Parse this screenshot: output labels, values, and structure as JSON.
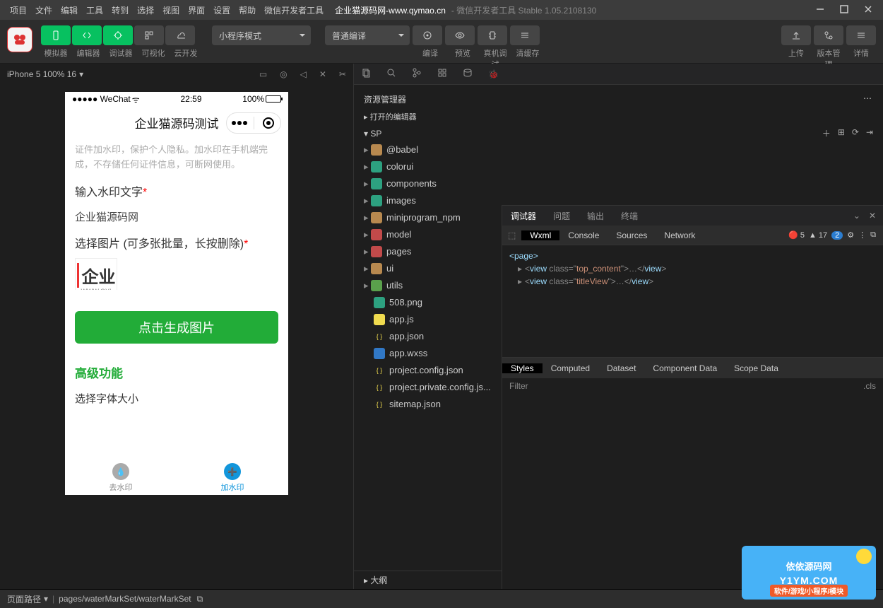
{
  "title_bar": {
    "menus": [
      "项目",
      "文件",
      "编辑",
      "工具",
      "转到",
      "选择",
      "视图",
      "界面",
      "设置",
      "帮助",
      "微信开发者工具"
    ],
    "project_title": "企业猫源码网-www.qymao.cn",
    "sub_title": " - 微信开发者工具 Stable 1.05.2108130"
  },
  "toolbar": {
    "left_labels": [
      "模拟器",
      "编辑器",
      "调试器",
      "可视化",
      "云开发"
    ],
    "mode_select": "小程序模式",
    "compile_select": "普通编译",
    "compile_labels": [
      "编译",
      "预览",
      "真机调试",
      "清缓存"
    ],
    "right_labels": [
      "上传",
      "版本管理",
      "详情"
    ]
  },
  "simulator": {
    "header": "iPhone 5 100% 16",
    "status_time": "22:59",
    "status_left": "●●●●● WeChat",
    "battery": "100%",
    "nav_title": "企业猫源码测试",
    "desc": "证件加水印，保护个人隐私。加水印在手机端完成，不存储任何证件信息，可断网使用。",
    "label_watermark": "输入水印文字",
    "watermark_value": "企业猫源码网",
    "label_images": "选择图片 (可多张批量，长按删除)",
    "thumb_text": "企业",
    "thumb_caption": "WWW.QYI",
    "generate_btn": "点击生成图片",
    "advanced": "高级功能",
    "font_label": "选择字体大小",
    "tab_remove": "去水印",
    "tab_add": "加水印"
  },
  "explorer": {
    "title": "资源管理器",
    "open_editors": "打开的编辑器",
    "project": "SP",
    "folders": [
      {
        "name": "@babel",
        "color": "folder"
      },
      {
        "name": "colorui",
        "color": "folder teal"
      },
      {
        "name": "components",
        "color": "folder teal"
      },
      {
        "name": "images",
        "color": "folder teal"
      },
      {
        "name": "miniprogram_npm",
        "color": "folder"
      },
      {
        "name": "model",
        "color": "folder red"
      },
      {
        "name": "pages",
        "color": "folder red"
      },
      {
        "name": "ui",
        "color": "folder"
      },
      {
        "name": "utils",
        "color": "folder green"
      }
    ],
    "files": [
      {
        "name": "508.png",
        "cls": "png"
      },
      {
        "name": "app.js",
        "cls": "js"
      },
      {
        "name": "app.json",
        "cls": "json"
      },
      {
        "name": "app.wxss",
        "cls": "wxss"
      },
      {
        "name": "project.config.json",
        "cls": "json"
      },
      {
        "name": "project.private.config.js...",
        "cls": "json"
      },
      {
        "name": "sitemap.json",
        "cls": "json"
      }
    ],
    "outline": "大纲"
  },
  "debugger": {
    "tabs": [
      "调试器",
      "问题",
      "输出",
      "终端"
    ],
    "devtabs": [
      "Wxml",
      "Console",
      "Sources",
      "Network"
    ],
    "errors": "5",
    "warnings": "17",
    "info": "2",
    "page_open": "<page>",
    "view1_tag": "view",
    "view1_class": "top_content",
    "view2_tag": "view",
    "view2_class": "titleView",
    "style_tabs": [
      "Styles",
      "Computed",
      "Dataset",
      "Component Data",
      "Scope Data"
    ],
    "filter_placeholder": "Filter",
    "cls": ".cls"
  },
  "status": {
    "route_label": "页面路径",
    "route": "pages/waterMarkSet/waterMarkSet"
  },
  "floater": {
    "line1": "依依源码网",
    "line2": "Y1YM.COM",
    "strip": "软件/游戏/小程序/模块"
  }
}
